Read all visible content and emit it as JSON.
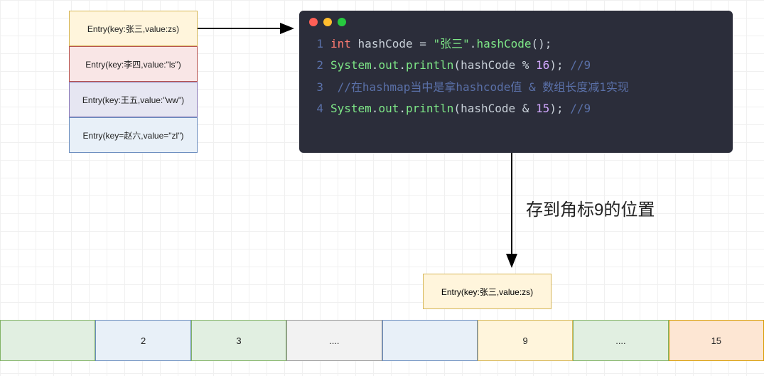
{
  "entries": [
    {
      "label": "Entry(key:张三,value:zs)"
    },
    {
      "label": "Entry(key:李四,value:\"ls\")"
    },
    {
      "label": "Entry(key:王五,value:\"ww\")"
    },
    {
      "label": "Entry(key=赵六,value=\"zl\")"
    }
  ],
  "code": {
    "l1": {
      "n": "1",
      "kw": "int",
      "id1": "hashCode",
      "eq": " = ",
      "str": "\"张三\"",
      "dot": ".",
      "fn": "hashCode",
      "paren": "();"
    },
    "l2": {
      "n": "2",
      "obj": "System",
      "d1": ".",
      "out": "out",
      "d2": ".",
      "fn": "println",
      "open": "(",
      "arg": "hashCode ",
      "op": "%",
      "sp": " ",
      "num": "16",
      "close": ");",
      "cm": " //9"
    },
    "l3": {
      "n": "3",
      "cm": " //在hashmap当中是拿hashcode值 & 数组长度减1实现"
    },
    "l4": {
      "n": "4",
      "obj": "System",
      "d1": ".",
      "out": "out",
      "d2": ".",
      "fn": "println",
      "open": "(",
      "arg": "hashCode ",
      "op": "&",
      "sp": " ",
      "num": "15",
      "close": ");",
      "cm": " //9"
    }
  },
  "annotation": "存到角标9的位置",
  "target_entry": "Entry(key:张三,value:zs)",
  "array_cells": [
    "",
    "2",
    "3",
    "....",
    "",
    "9",
    "....",
    "15"
  ]
}
